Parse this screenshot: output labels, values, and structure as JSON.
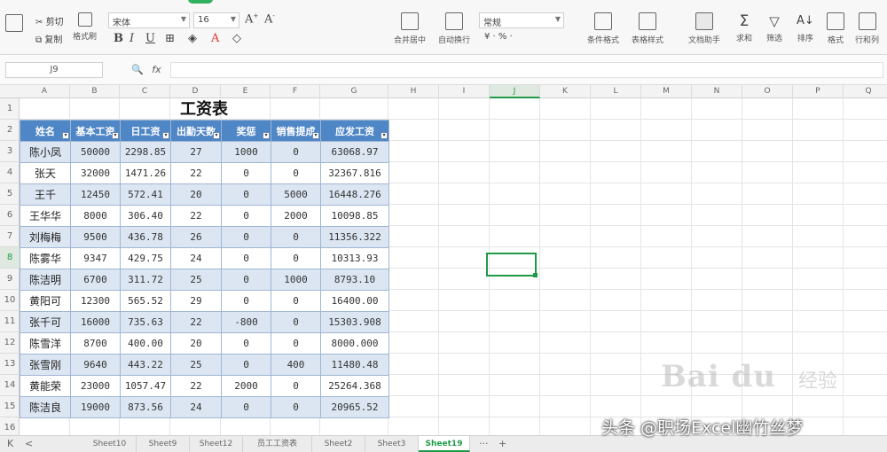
{
  "ribbon": {
    "clipboard": {
      "cut": "剪切",
      "copy": "复制",
      "format_painter": "格式刷"
    },
    "font": {
      "name": "宋体",
      "size": "16",
      "bold": "B",
      "italic": "I",
      "underline": "U",
      "font_color": "A"
    },
    "align": {
      "merge_center": "合并居中",
      "wrap": "自动换行"
    },
    "number": {
      "format": "常规",
      "symbols": "¥ · % ·"
    },
    "styles": {
      "cond_format": "条件格式",
      "table_style": "表格样式"
    },
    "tools": {
      "doc_assist": "文档助手",
      "sum": "求和",
      "filter": "筛选",
      "sort": "排序",
      "format": "格式",
      "rowcol": "行和列"
    }
  },
  "formula_bar": {
    "name_box": "J9",
    "fx": "fx",
    "value": ""
  },
  "columns": [
    "A",
    "B",
    "C",
    "D",
    "E",
    "F",
    "G",
    "H",
    "I",
    "J",
    "K",
    "L",
    "M",
    "N",
    "O",
    "P",
    "Q"
  ],
  "rows": [
    "1",
    "2",
    "3",
    "4",
    "5",
    "6",
    "7",
    "8",
    "9",
    "10",
    "11",
    "12",
    "13",
    "14",
    "15",
    "16"
  ],
  "table": {
    "title": "工资表",
    "headers": [
      "姓名",
      "基本工资",
      "日工资",
      "出勤天数",
      "奖惩",
      "销售提成",
      "应发工资"
    ],
    "rows": [
      [
        "陈小凤",
        "50000",
        "2298.85",
        "27",
        "1000",
        "0",
        "63068.97"
      ],
      [
        "张天",
        "32000",
        "1471.26",
        "22",
        "0",
        "0",
        "32367.816"
      ],
      [
        "王千",
        "12450",
        "572.41",
        "20",
        "0",
        "5000",
        "16448.276"
      ],
      [
        "王华华",
        "8000",
        "306.40",
        "22",
        "0",
        "2000",
        "10098.85"
      ],
      [
        "刘梅梅",
        "9500",
        "436.78",
        "26",
        "0",
        "0",
        "11356.322"
      ],
      [
        "陈雾华",
        "9347",
        "429.75",
        "24",
        "0",
        "0",
        "10313.93"
      ],
      [
        "陈洁明",
        "6700",
        "311.72",
        "25",
        "0",
        "1000",
        "8793.10"
      ],
      [
        "黄阳可",
        "12300",
        "565.52",
        "29",
        "0",
        "0",
        "16400.00"
      ],
      [
        "张千可",
        "16000",
        "735.63",
        "22",
        "-800",
        "0",
        "15303.908"
      ],
      [
        "陈雪洋",
        "8700",
        "400.00",
        "20",
        "0",
        "0",
        "8000.000"
      ],
      [
        "张雪刚",
        "9640",
        "443.22",
        "25",
        "0",
        "400",
        "11480.48"
      ],
      [
        "黄能荣",
        "23000",
        "1057.47",
        "22",
        "2000",
        "0",
        "25264.368"
      ],
      [
        "陈洁良",
        "19000",
        "873.56",
        "24",
        "0",
        "0",
        "20965.52"
      ]
    ]
  },
  "sheet_tabs": {
    "nav_first": "K",
    "nav_prev": "<",
    "tabs": [
      "Sheet10",
      "Sheet9",
      "Sheet12",
      "员工工资表",
      "Sheet2",
      "Sheet3",
      "Sheet19"
    ],
    "more": "···",
    "add": "+"
  },
  "watermarks": {
    "baidu": "Bai du",
    "jingyan": "经验",
    "toutiao": "头条 @职场Excel幽竹丝梦"
  }
}
